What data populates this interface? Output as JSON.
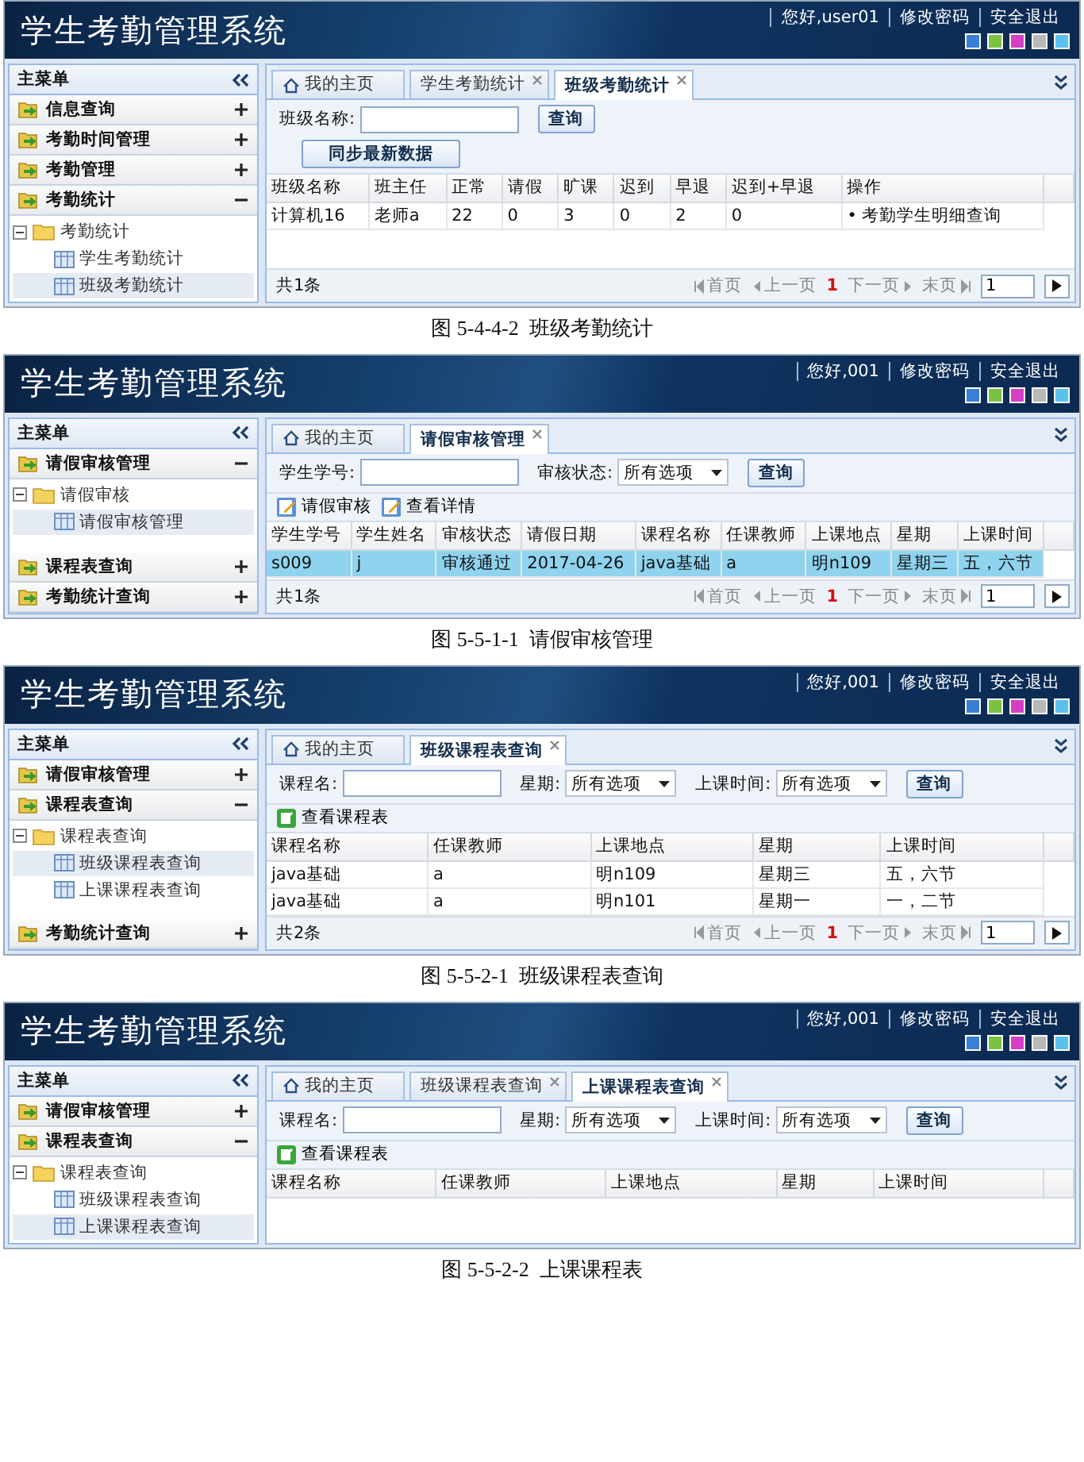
{
  "figures": [
    {
      "header": {
        "title": "学生考勤管理系统",
        "links": [
          "您好,user01",
          "修改密码",
          "安全退出"
        ],
        "themes": [
          {
            "color": "#3a7fd5"
          },
          {
            "color": "#7cc242"
          },
          {
            "color": "#d63fc4"
          },
          {
            "color": "#b8b8b8"
          },
          {
            "color": "#5cc0ee"
          }
        ]
      },
      "sidebar": {
        "title": "主菜单",
        "sections": [
          {
            "label": "信息查询",
            "expanded": false
          },
          {
            "label": "考勤时间管理",
            "expanded": false
          },
          {
            "label": "考勤管理",
            "expanded": false
          },
          {
            "label": "考勤统计",
            "expanded": true,
            "tree": {
              "label": "考勤统计",
              "children": [
                {
                  "label": "学生考勤统计",
                  "selected": false
                },
                {
                  "label": "班级考勤统计",
                  "selected": true
                }
              ]
            }
          }
        ]
      },
      "tabs": [
        {
          "label": "我的主页",
          "kind": "home",
          "selected": false
        },
        {
          "label": "学生考勤统计",
          "kind": "closable",
          "selected": false
        },
        {
          "label": "班级考勤统计",
          "kind": "closable",
          "selected": true
        }
      ],
      "form": {
        "fields": [
          {
            "kind": "input",
            "label": "班级名称:"
          }
        ],
        "button": "查询",
        "extra_button": "同步最新数据"
      },
      "table": {
        "columns": [
          "班级名称",
          "班主任",
          "正常",
          "请假",
          "旷课",
          "迟到",
          "早退",
          "迟到+早退",
          "操作"
        ],
        "rows": [
          {
            "cells": [
              "计算机16",
              "老师a",
              "22",
              "0",
              "3",
              "0",
              "2",
              "0",
              "• 考勤学生明细查询"
            ],
            "selected": false
          }
        ]
      },
      "footer": {
        "count": "共1条",
        "pager": [
          {
            "label": "首页",
            "kind": "first"
          },
          {
            "label": "上一页",
            "kind": "prev"
          },
          {
            "label": "1",
            "kind": "current"
          },
          {
            "label": "下一页",
            "kind": "next"
          },
          {
            "label": "末页",
            "kind": "last"
          }
        ],
        "page": "1"
      },
      "caption": "图 5-4-4-2  班级考勤统计"
    },
    {
      "header": {
        "title": "学生考勤管理系统",
        "links": [
          "您好,001",
          "修改密码",
          "安全退出"
        ],
        "themes": [
          {
            "color": "#3a7fd5"
          },
          {
            "color": "#7cc242"
          },
          {
            "color": "#d63fc4"
          },
          {
            "color": "#b8b8b8"
          },
          {
            "color": "#5cc0ee"
          }
        ]
      },
      "sidebar": {
        "title": "主菜单",
        "sections": [
          {
            "label": "请假审核管理",
            "expanded": true,
            "tree": {
              "label": "请假审核",
              "children": [
                {
                  "label": "请假审核管理",
                  "selected": true
                }
              ]
            }
          },
          {
            "label": "课程表查询",
            "expanded": false
          },
          {
            "label": "考勤统计查询",
            "expanded": false
          }
        ]
      },
      "tabs": [
        {
          "label": "我的主页",
          "kind": "home",
          "selected": false
        },
        {
          "label": "请假审核管理",
          "kind": "closable",
          "selected": true
        }
      ],
      "form": {
        "fields": [
          {
            "kind": "input",
            "label": "学生学号:"
          },
          {
            "kind": "select",
            "label": "审核状态:",
            "value": "所有选项"
          }
        ],
        "button": "查询"
      },
      "toolbar": [
        {
          "label": "请假审核",
          "kind": "edit"
        },
        {
          "label": "查看详情",
          "kind": "edit"
        }
      ],
      "table": {
        "columns": [
          "学生学号",
          "学生姓名",
          "审核状态",
          "请假日期",
          "课程名称",
          "任课教师",
          "上课地点",
          "星期",
          "上课时间"
        ],
        "rows": [
          {
            "cells": [
              "s009",
              "j",
              "审核通过",
              "2017-04-26",
              "java基础",
              "a",
              "明n109",
              "星期三",
              "五，六节"
            ],
            "selected": true
          }
        ]
      },
      "footer": {
        "count": "共1条",
        "pager": [
          {
            "label": "首页",
            "kind": "first"
          },
          {
            "label": "上一页",
            "kind": "prev"
          },
          {
            "label": "1",
            "kind": "current"
          },
          {
            "label": "下一页",
            "kind": "next"
          },
          {
            "label": "末页",
            "kind": "last"
          }
        ],
        "page": "1"
      },
      "caption": "图 5-5-1-1  请假审核管理"
    },
    {
      "header": {
        "title": "学生考勤管理系统",
        "links": [
          "您好,001",
          "修改密码",
          "安全退出"
        ],
        "themes": [
          {
            "color": "#3a7fd5"
          },
          {
            "color": "#7cc242"
          },
          {
            "color": "#d63fc4"
          },
          {
            "color": "#b8b8b8"
          },
          {
            "color": "#5cc0ee"
          }
        ]
      },
      "sidebar": {
        "title": "主菜单",
        "sections": [
          {
            "label": "请假审核管理",
            "expanded": false
          },
          {
            "label": "课程表查询",
            "expanded": true,
            "tree": {
              "label": "课程表查询",
              "children": [
                {
                  "label": "班级课程表查询",
                  "selected": true
                },
                {
                  "label": "上课课程表查询",
                  "selected": false
                }
              ]
            }
          },
          {
            "label": "考勤统计查询",
            "expanded": false
          }
        ]
      },
      "tabs": [
        {
          "label": "我的主页",
          "kind": "home",
          "selected": false
        },
        {
          "label": "班级课程表查询",
          "kind": "closable",
          "selected": true
        }
      ],
      "form": {
        "fields": [
          {
            "kind": "input",
            "label": "课程名:"
          },
          {
            "kind": "select",
            "label": "星期:",
            "value": "所有选项"
          },
          {
            "kind": "select",
            "label": "上课时间:",
            "value": "所有选项"
          }
        ],
        "button": "查询"
      },
      "toolbar": [
        {
          "label": "查看课程表",
          "kind": "view"
        }
      ],
      "table": {
        "columns": [
          "课程名称",
          "任课教师",
          "上课地点",
          "星期",
          "上课时间"
        ],
        "rows": [
          {
            "cells": [
              "java基础",
              "a",
              "明n109",
              "星期三",
              "五，六节"
            ],
            "selected": false
          },
          {
            "cells": [
              "java基础",
              "a",
              "明n101",
              "星期一",
              "一，二节"
            ],
            "selected": false
          }
        ]
      },
      "footer": {
        "count": "共2条",
        "pager": [
          {
            "label": "首页",
            "kind": "first"
          },
          {
            "label": "上一页",
            "kind": "prev"
          },
          {
            "label": "1",
            "kind": "current"
          },
          {
            "label": "下一页",
            "kind": "next"
          },
          {
            "label": "末页",
            "kind": "last"
          }
        ],
        "page": "1"
      },
      "caption": "图 5-5-2-1  班级课程表查询"
    },
    {
      "header": {
        "title": "学生考勤管理系统",
        "links": [
          "您好,001",
          "修改密码",
          "安全退出"
        ],
        "themes": [
          {
            "color": "#3a7fd5"
          },
          {
            "color": "#7cc242"
          },
          {
            "color": "#d63fc4"
          },
          {
            "color": "#b8b8b8"
          },
          {
            "color": "#5cc0ee"
          }
        ]
      },
      "sidebar": {
        "title": "主菜单",
        "sections": [
          {
            "label": "请假审核管理",
            "expanded": false
          },
          {
            "label": "课程表查询",
            "expanded": true,
            "tree": {
              "label": "课程表查询",
              "children": [
                {
                  "label": "班级课程表查询",
                  "selected": false
                },
                {
                  "label": "上课课程表查询",
                  "selected": true
                }
              ]
            }
          }
        ]
      },
      "tabs": [
        {
          "label": "我的主页",
          "kind": "home",
          "selected": false
        },
        {
          "label": "班级课程表查询",
          "kind": "closable",
          "selected": false
        },
        {
          "label": "上课课程表查询",
          "kind": "closable",
          "selected": true
        }
      ],
      "form": {
        "fields": [
          {
            "kind": "input",
            "label": "课程名:"
          },
          {
            "kind": "select",
            "label": "星期:",
            "value": "所有选项"
          },
          {
            "kind": "select",
            "label": "上课时间:",
            "value": "所有选项"
          }
        ],
        "button": "查询"
      },
      "toolbar": [
        {
          "label": "查看课程表",
          "kind": "view"
        }
      ],
      "table": {
        "columns": [
          "课程名称",
          "任课教师",
          "上课地点",
          "星期",
          "上课时间"
        ]
      },
      "caption": "图 5-5-2-2  上课课程表"
    }
  ]
}
